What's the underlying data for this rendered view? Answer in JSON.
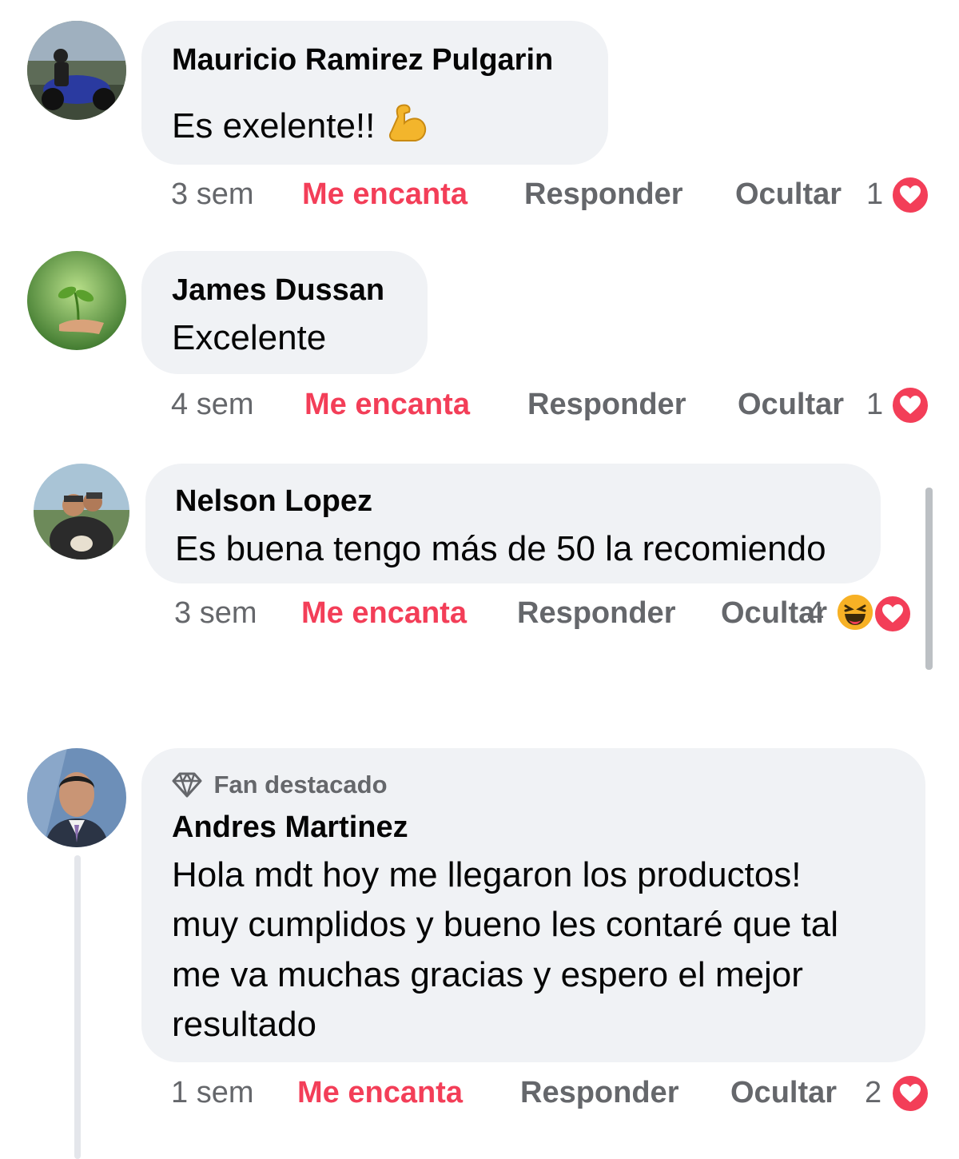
{
  "comments": [
    {
      "author": "Mauricio Ramirez Pulgarin",
      "text": "Es exelente!!",
      "emoji": "flexed-biceps",
      "time": "3 sem",
      "love_label": "Me encanta",
      "reply_label": "Responder",
      "hide_label": "Ocultar",
      "reaction_count": "1"
    },
    {
      "author": "James Dussan",
      "text": "Excelente",
      "time": "4 sem",
      "love_label": "Me encanta",
      "reply_label": "Responder",
      "hide_label": "Ocultar",
      "reaction_count": "1"
    },
    {
      "author": "Nelson Lopez",
      "text": "Es buena tengo más de 50 la recomiendo",
      "time": "3 sem",
      "love_label": "Me encanta",
      "reply_label": "Responder",
      "hide_label": "Ocultar",
      "reaction_count": "4"
    },
    {
      "badge": "Fan destacado",
      "author": "Andres Martinez",
      "text_lines": [
        "Hola mdt hoy me llegaron los productos!",
        "muy cumplidos y bueno les contaré que tal",
        "me va muchas gracias y espero el mejor",
        "resultado"
      ],
      "time": "1 sem",
      "love_label": "Me encanta",
      "reply_label": "Responder",
      "hide_label": "Ocultar",
      "reaction_count": "2"
    }
  ],
  "colors": {
    "love": "#f33e58",
    "bubble": "#f0f2f5",
    "muted": "#65676b"
  }
}
